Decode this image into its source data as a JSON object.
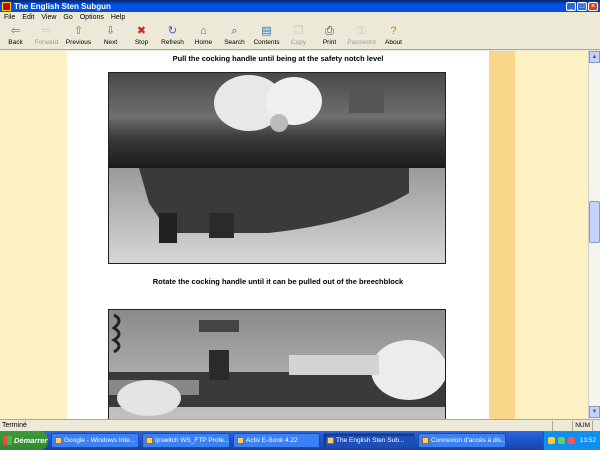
{
  "window": {
    "title": "The English Sten Subgun",
    "buttons": {
      "minimize": "_",
      "maximize": "□",
      "close": "×"
    }
  },
  "menu": [
    "File",
    "Edit",
    "View",
    "Go",
    "Options",
    "Help"
  ],
  "toolbar": [
    {
      "label": "Back",
      "icon": "arrow-left-icon",
      "glyph": "⇦",
      "color": "#2e8b57",
      "enabled": true
    },
    {
      "label": "Forward",
      "icon": "arrow-right-icon",
      "glyph": "⇨",
      "color": "#888888",
      "enabled": false
    },
    {
      "label": "Previous",
      "icon": "arrow-up-icon",
      "glyph": "⇧",
      "color": "#2aa52a",
      "enabled": true
    },
    {
      "label": "Next",
      "icon": "arrow-down-icon",
      "glyph": "⇩",
      "color": "#2aa52a",
      "enabled": true
    },
    {
      "label": "Stop",
      "icon": "stop-icon",
      "glyph": "✖",
      "color": "#d42020",
      "enabled": true
    },
    {
      "label": "Refresh",
      "icon": "refresh-icon",
      "glyph": "↻",
      "color": "#2e6cb8",
      "enabled": true
    },
    {
      "label": "Home",
      "icon": "home-icon",
      "glyph": "⌂",
      "color": "#b06010",
      "enabled": true
    },
    {
      "label": "Search",
      "icon": "search-icon",
      "glyph": "⌕",
      "color": "#2e6cb8",
      "enabled": true
    },
    {
      "label": "Contents",
      "icon": "contents-icon",
      "glyph": "▤",
      "color": "#2e6cb8",
      "enabled": true
    },
    {
      "label": "Copy",
      "icon": "copy-icon",
      "glyph": "❐",
      "color": "#888888",
      "enabled": false
    },
    {
      "label": "Print",
      "icon": "print-icon",
      "glyph": "⎙",
      "color": "#444444",
      "enabled": true
    },
    {
      "label": "Password",
      "icon": "key-icon",
      "glyph": "⚿",
      "color": "#888888",
      "enabled": false
    },
    {
      "label": "About",
      "icon": "about-icon",
      "glyph": "?",
      "color": "#c08a00",
      "enabled": true
    }
  ],
  "content": {
    "caption_1": "Pull the cocking handle until being at the safety notch level",
    "caption_2": "Rotate the cocking handle until it can be pulled out of the breechblock",
    "colors": {
      "margin": "#fdf1c4",
      "strip": "#f9d78a",
      "page": "#ffffff"
    }
  },
  "status": {
    "text": "Terminé",
    "num": "NUM"
  },
  "taskbar": {
    "start": "Démarrer",
    "tasks": [
      {
        "label": "Google - Windows Inte...",
        "active": false
      },
      {
        "label": "Ipswitch WS_FTP Profe...",
        "active": false
      },
      {
        "label": "Activ E-Book 4.22",
        "active": false
      },
      {
        "label": "The English Sten Sub...",
        "active": true
      },
      {
        "label": "Connexion d'accès à dis...",
        "active": false
      }
    ],
    "clock": "13:52"
  }
}
